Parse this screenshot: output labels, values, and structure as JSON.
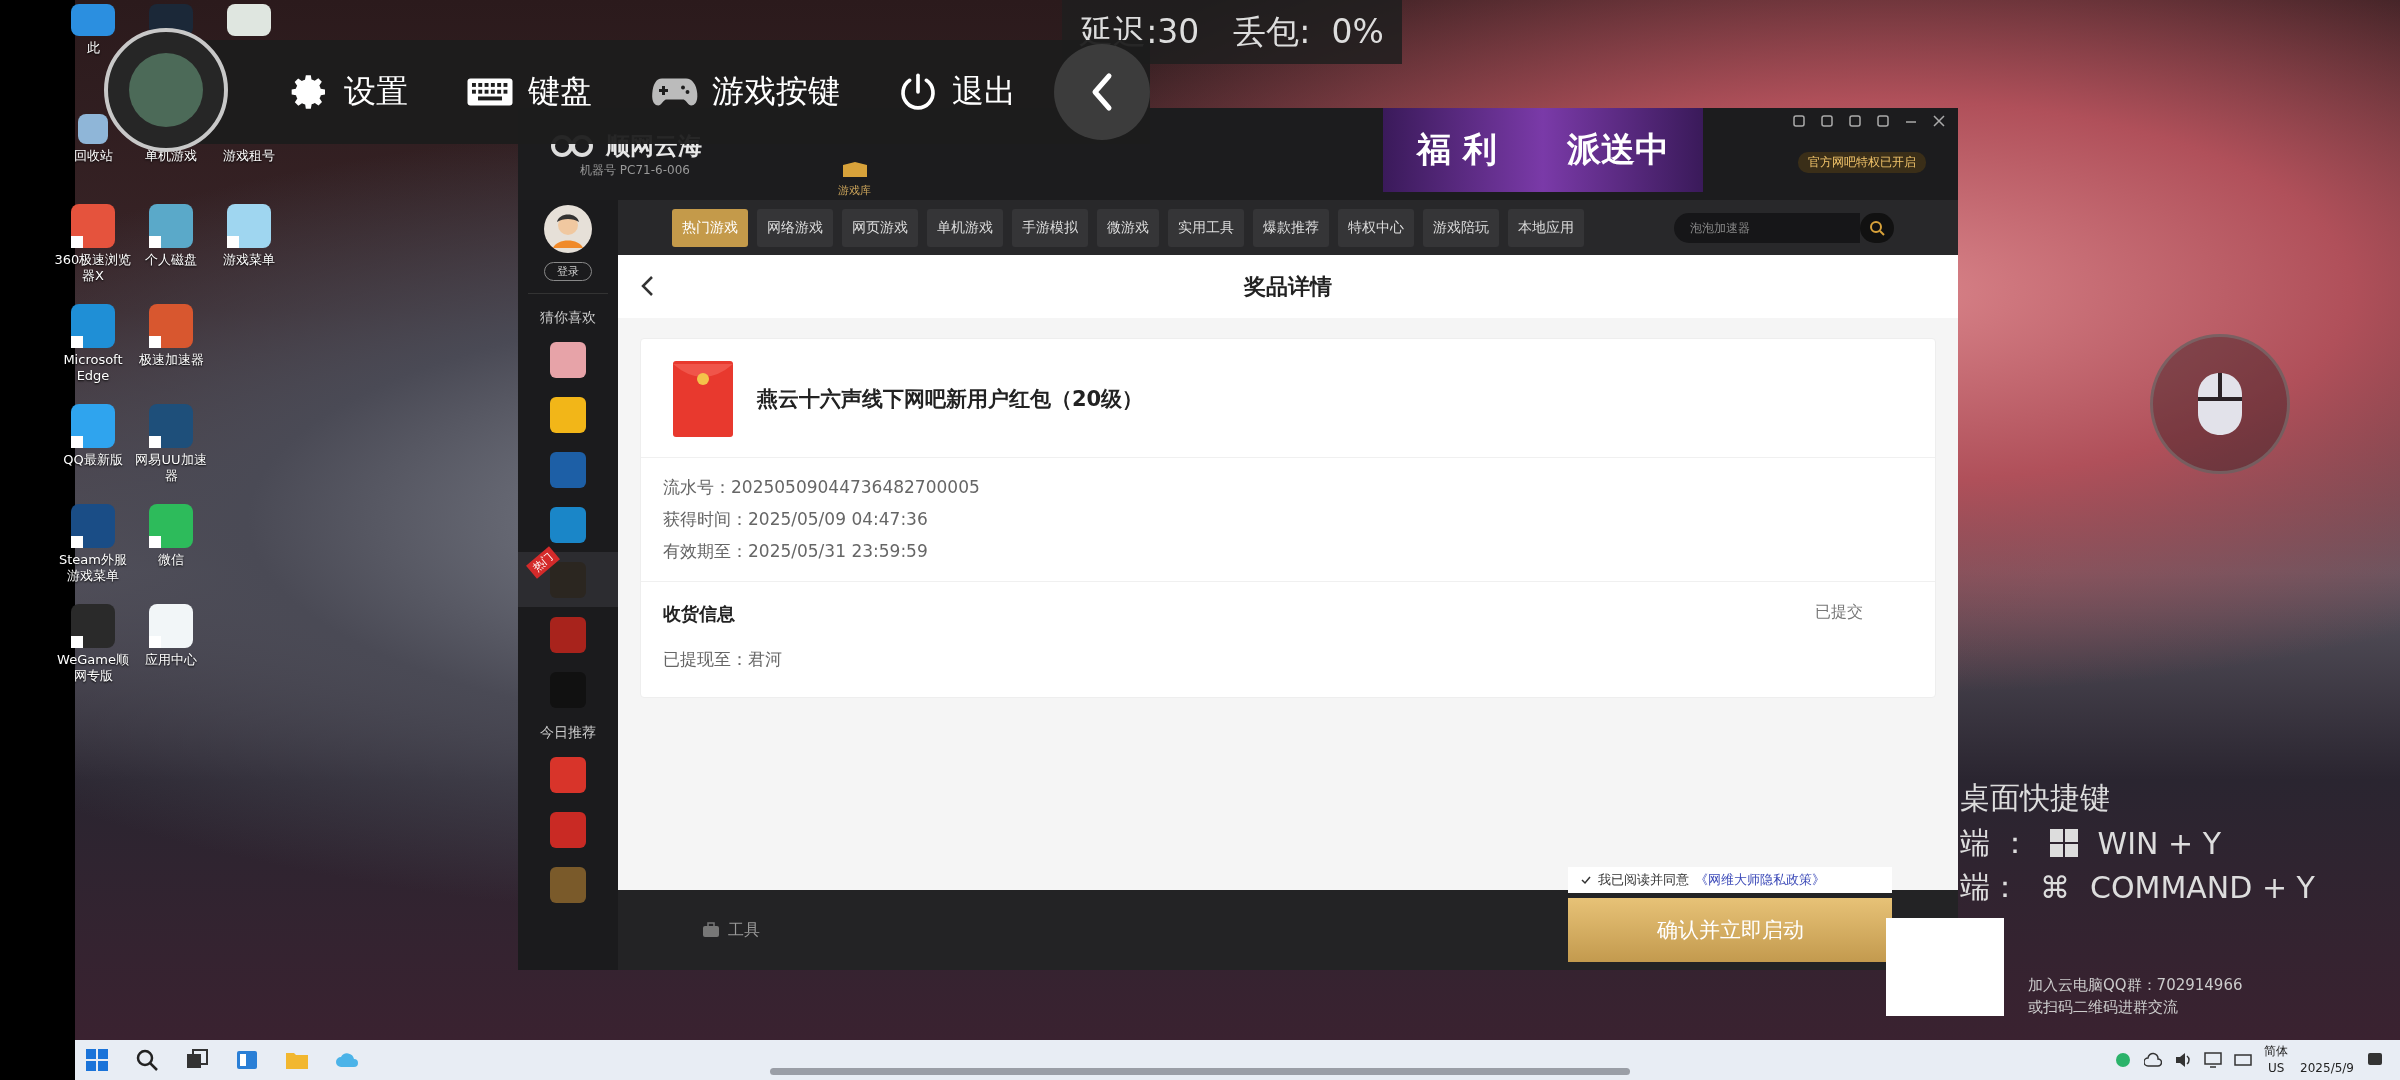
{
  "stream_overlay": {
    "latency": "延迟:30",
    "packet_loss": "丢包:  0%",
    "menu": [
      {
        "kind": "settings",
        "label": "设置"
      },
      {
        "kind": "keyboard",
        "label": "键盘"
      },
      {
        "kind": "gamepad",
        "label": "游戏按键"
      },
      {
        "kind": "power",
        "label": "退出"
      }
    ]
  },
  "desktop_icons": [
    [
      {
        "label": "此",
        "color": "#2b8fe0"
      },
      {
        "color": "#1b2838"
      },
      {
        "color": "#dfe6e0"
      }
    ],
    [
      {
        "label": "回收站",
        "color": "#8fb6d8"
      },
      {
        "label": "单机游戏"
      },
      {
        "label": "游戏租号"
      }
    ],
    [
      {
        "label": "360极速浏览器X",
        "color": "#e5533d"
      },
      {
        "label": "个人磁盘",
        "color": "#5aa9c9"
      },
      {
        "label": "游戏菜单",
        "color": "#9fd6f0"
      }
    ],
    [
      {
        "label": "Microsoft Edge",
        "color": "#1f8fd6"
      },
      {
        "label": "极速加速器",
        "color": "#d8572f"
      }
    ],
    [
      {
        "label": "QQ最新版",
        "color": "#2fa4ee"
      },
      {
        "label": "网易UU加速器",
        "color": "#1e4f7a"
      }
    ],
    [
      {
        "label": "Steam外服游戏菜单",
        "color": "#1a4d86"
      },
      {
        "label": "微信",
        "color": "#2dbb5b"
      }
    ],
    [
      {
        "label": "WeGame顺网专版",
        "color": "#2a2a2a"
      },
      {
        "label": "应用中心",
        "color": "#f2f6f8"
      }
    ]
  ],
  "app_window": {
    "logo": "顺网云海",
    "machine_id": "机器号 PC71-6-006",
    "library": "游戏库",
    "banner": [
      "福 利",
      "派送中"
    ],
    "privilege": "官方网吧特权已开启",
    "login": "登录",
    "sidebar": [
      {
        "kind": "heading",
        "label": "猜你喜欢"
      },
      {
        "kind": "game",
        "color": "#e7a3a8"
      },
      {
        "kind": "game",
        "color": "#f2b618"
      },
      {
        "kind": "game",
        "color": "#1d5fa6"
      },
      {
        "kind": "game",
        "color": "#1a86c8"
      },
      {
        "kind": "game",
        "color": "#2b2620",
        "badge": "热门"
      },
      {
        "kind": "game",
        "color": "#a8231c"
      },
      {
        "kind": "game",
        "color": "#111111"
      },
      {
        "kind": "heading",
        "label": "今日推荐"
      },
      {
        "kind": "game",
        "color": "#d8342a"
      },
      {
        "kind": "game",
        "color": "#c92a24"
      },
      {
        "kind": "game",
        "color": "#7a5a2a"
      }
    ],
    "nav": [
      {
        "label": "热门游戏",
        "selected": true
      },
      {
        "label": "网络游戏",
        "selected": false
      },
      {
        "label": "网页游戏",
        "selected": false
      },
      {
        "label": "单机游戏",
        "selected": false
      },
      {
        "label": "手游模拟",
        "selected": false
      },
      {
        "label": "微游戏",
        "selected": false
      },
      {
        "label": "实用工具",
        "selected": false
      },
      {
        "label": "爆款推荐",
        "selected": false
      },
      {
        "label": "特权中心",
        "selected": false
      },
      {
        "label": "游戏陪玩",
        "selected": false
      },
      {
        "label": "本地应用",
        "selected": false
      }
    ],
    "search": {
      "placeholder": "泡泡加速器"
    },
    "page_title": "奖品详情",
    "prize": {
      "title": "燕云十六声线下网吧新用户红包（20级）",
      "details": [
        "流水号：20250509044736482700005",
        "获得时间：2025/05/09 04:47:36",
        "有效期至：2025/05/31 23:59:59"
      ],
      "shipping_heading": "收货信息",
      "shipping_status": "已提交",
      "shipping_detail": "已提现至：君河"
    },
    "footer": {
      "tools": "工具",
      "agreement": {
        "checked": true,
        "text": "我已阅读并同意",
        "link": "《网维大师隐私政策》"
      },
      "launch_button": "确认并立即启动"
    }
  },
  "shortcuts": {
    "title": "桌面快捷键",
    "rows": [
      {
        "kind": "windows",
        "label": "端 ：",
        "keys": "WIN + Y"
      },
      {
        "kind": "mac",
        "label": "端：",
        "symbol": "⌘",
        "keys": "COMMAND + Y"
      }
    ]
  },
  "qq_group": [
    "加入云电脑QQ群：702914966",
    "或扫码二维码进群交流"
  ],
  "taskbar": {
    "ime": "简体",
    "layout": "US",
    "date": "2025/5/9"
  }
}
